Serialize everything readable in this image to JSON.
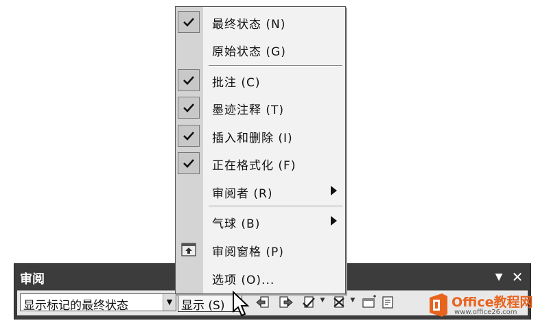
{
  "menu": {
    "items": [
      {
        "label": "最终状态 (N)",
        "checked": true
      },
      {
        "label": "原始状态 (G)",
        "checked": false
      },
      {
        "label": "批注 (C)",
        "checked": true
      },
      {
        "label": "墨迹注释 (T)",
        "checked": true
      },
      {
        "label": "插入和删除 (I)",
        "checked": true
      },
      {
        "label": "正在格式化 (F)",
        "checked": true
      },
      {
        "label": "审阅者 (R)",
        "checked": false,
        "submenu": true
      },
      {
        "label": "气球 (B)",
        "checked": false,
        "submenu": true
      },
      {
        "label": "审阅窗格 (P)",
        "checked": false,
        "icon": "review-pane-icon"
      },
      {
        "label": "选项 (O)...",
        "checked": false
      }
    ]
  },
  "toolbar": {
    "title": "审阅",
    "display_select": {
      "value": "显示标记的最终状态"
    },
    "show_button": {
      "label": "显示 (S)"
    },
    "buttons": [
      {
        "icon": "previous-change-icon"
      },
      {
        "icon": "next-change-icon"
      },
      {
        "icon": "accept-change-icon"
      },
      {
        "icon": "reject-change-icon"
      },
      {
        "icon": "new-comment-icon"
      }
    ]
  },
  "watermark": {
    "brand": "Office教程网",
    "url": "www.office26.com"
  },
  "colors": {
    "titlebar": "#3c3c3c",
    "menu_bg": "#f2f2f2",
    "menu_gutter": "#d4d4d4",
    "logo_orange": "#e8631e"
  }
}
